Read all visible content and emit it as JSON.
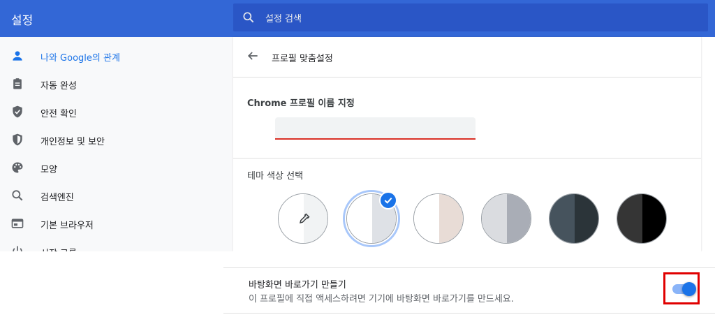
{
  "header": {
    "title": "설정",
    "search_placeholder": "설정 검색",
    "color": "#3367d6"
  },
  "sidebar": {
    "items": [
      {
        "label": "나와 Google의 관계",
        "icon": "person-icon",
        "active": true
      },
      {
        "label": "자동 완성",
        "icon": "clipboard-icon"
      },
      {
        "label": "안전 확인",
        "icon": "shield-check-icon"
      },
      {
        "label": "개인정보 및 보안",
        "icon": "shield-half-icon"
      },
      {
        "label": "모양",
        "icon": "palette-icon"
      },
      {
        "label": "검색엔진",
        "icon": "search-icon"
      },
      {
        "label": "기본 브라우저",
        "icon": "browser-icon"
      },
      {
        "label": "시작 그룹",
        "icon": "power-icon"
      }
    ]
  },
  "main": {
    "page_title": "프로필 맞춤설정",
    "profile_name_label": "Chrome 프로필 이름 지정",
    "profile_name_value": "",
    "theme_label": "테마 색상 선택",
    "themes": [
      {
        "left": "#ffffff",
        "right": "#f1f3f4",
        "kind": "custom-picker"
      },
      {
        "left": "#ffffff",
        "right": "#dee1e6",
        "selected": true
      },
      {
        "left": "#ffffff",
        "right": "#e8dcd6"
      },
      {
        "left": "#dadce0",
        "right": "#a9adb6"
      },
      {
        "left": "#46535d",
        "right": "#2b3439"
      },
      {
        "left": "#353535",
        "right": "#000000"
      }
    ]
  },
  "shortcut": {
    "title": "바탕화면 바로가기 만들기",
    "description": "이 프로필에 직접 액세스하려면 기기에 바탕화면 바로가기를 만드세요.",
    "enabled": true,
    "accent": "#1a73e8",
    "highlight_color": "#e00000"
  }
}
